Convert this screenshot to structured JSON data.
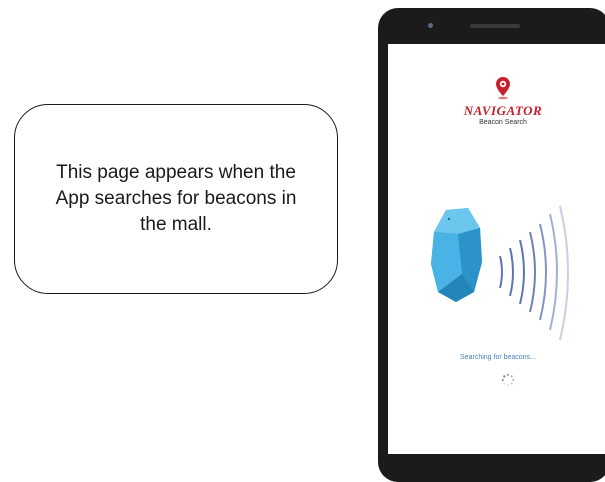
{
  "callout": {
    "text": "This page appears when the App searches for beacons in the mall."
  },
  "app": {
    "title": "NAVIGATOR",
    "subtitle": "Beacon Search",
    "status": "Searching for beacons..."
  },
  "icons": {
    "logo": "location-pin-icon",
    "beacon": "beacon-device-icon",
    "signal": "signal-waves-icon",
    "loading": "loading-spinner-icon"
  },
  "colors": {
    "brand": "#c8202a",
    "beacon": "#3aa8de",
    "status_text": "#4a7fc0",
    "phone_body": "#1b1b1b"
  }
}
